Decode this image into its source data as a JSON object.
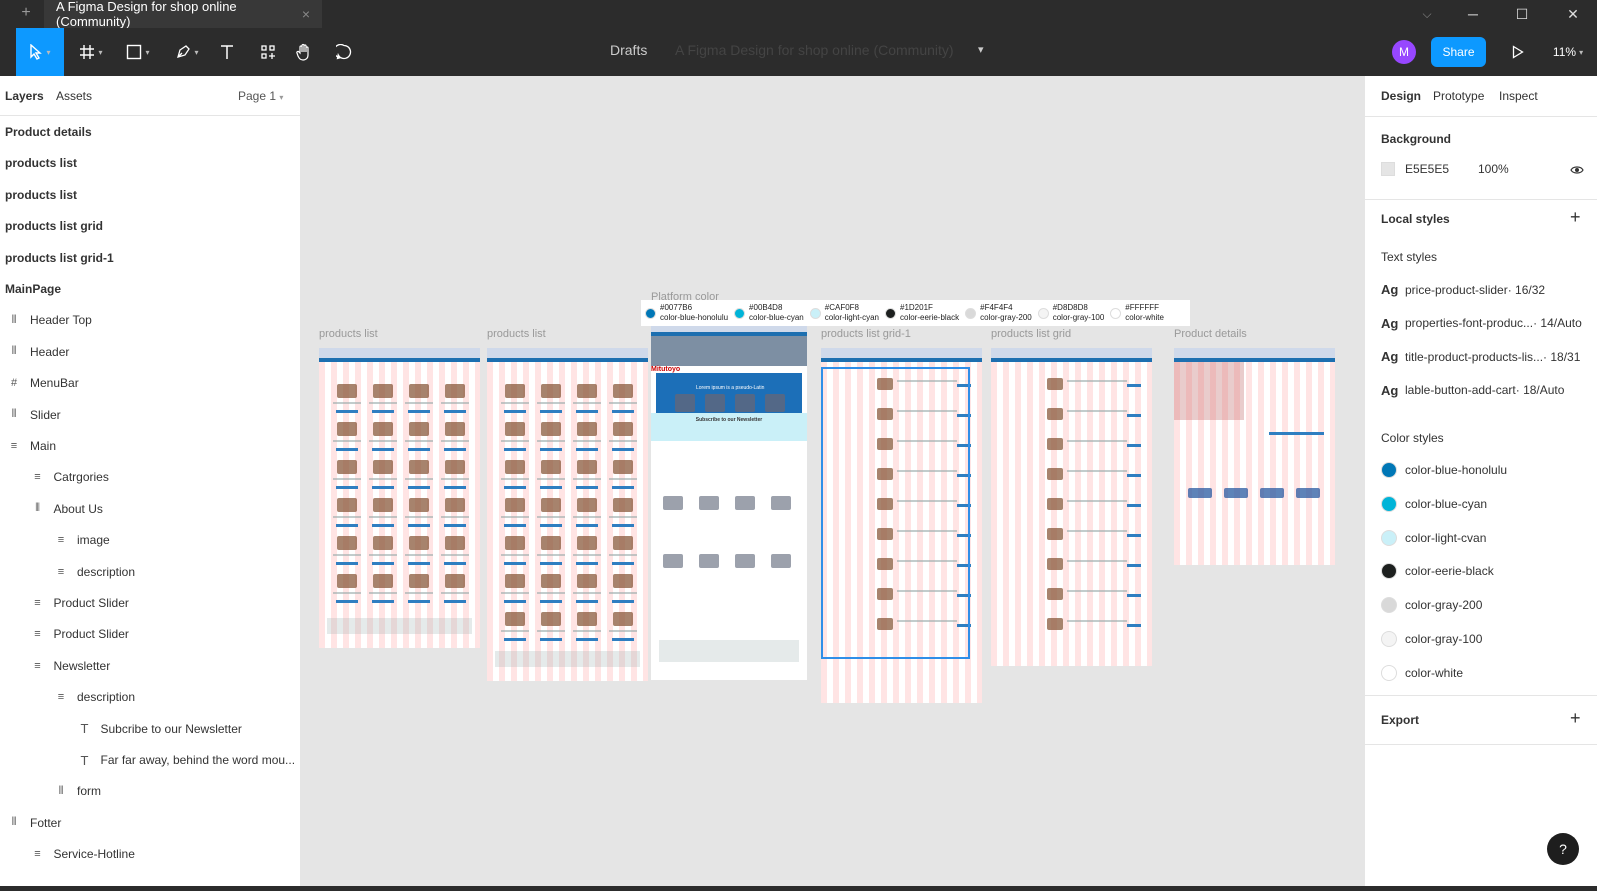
{
  "titlebar": {
    "plus": "+",
    "tab_title": "A Figma Design for shop online (Community)",
    "tab_close": "×",
    "chevron": "⌵",
    "minimize": "─",
    "maximize": "☐",
    "close": "✕"
  },
  "toolbar": {
    "location": "Drafts",
    "file_name": "A Figma Design for shop online (Community)",
    "avatar_initial": "M",
    "share_label": "Share",
    "zoom": "11%"
  },
  "left_panel": {
    "tabs": [
      "Layers",
      "Assets"
    ],
    "page_selector": "Page 1",
    "pages": [
      "Product details",
      "products list",
      "products list",
      "products list grid",
      "products list grid-1",
      "MainPage"
    ],
    "layers": [
      {
        "name": "Header Top",
        "icon": "auto-layout-icon",
        "glyph": "⫴",
        "indent": 0
      },
      {
        "name": "Header",
        "icon": "auto-layout-icon",
        "glyph": "⫴",
        "indent": 0
      },
      {
        "name": "MenuBar",
        "icon": "frame-icon",
        "glyph": "#",
        "indent": 0
      },
      {
        "name": "Slider",
        "icon": "auto-layout-icon",
        "glyph": "⫴",
        "indent": 0
      },
      {
        "name": "Main",
        "icon": "vertical-layout-icon",
        "glyph": "≡",
        "indent": 0
      },
      {
        "name": "Catrgories",
        "icon": "vertical-layout-icon",
        "glyph": "≡",
        "indent": 1
      },
      {
        "name": "About Us",
        "icon": "auto-layout-icon",
        "glyph": "⫴",
        "indent": 1
      },
      {
        "name": "image",
        "icon": "vertical-layout-icon",
        "glyph": "≡",
        "indent": 2
      },
      {
        "name": "description",
        "icon": "vertical-layout-icon",
        "glyph": "≡",
        "indent": 2
      },
      {
        "name": "Product Slider",
        "icon": "vertical-layout-icon",
        "glyph": "≡",
        "indent": 1
      },
      {
        "name": "Product Slider",
        "icon": "vertical-layout-icon",
        "glyph": "≡",
        "indent": 1
      },
      {
        "name": "Newsletter",
        "icon": "vertical-layout-icon",
        "glyph": "≡",
        "indent": 1
      },
      {
        "name": "description",
        "icon": "vertical-layout-icon",
        "glyph": "≡",
        "indent": 2
      },
      {
        "name": "Subcribe to our Newsletter",
        "icon": "text-icon",
        "glyph": "T",
        "indent": 3
      },
      {
        "name": "Far far away, behind the word mou...",
        "icon": "text-icon",
        "glyph": "T",
        "indent": 3
      },
      {
        "name": "form",
        "icon": "auto-layout-icon",
        "glyph": "⫴",
        "indent": 2
      },
      {
        "name": "Fotter",
        "icon": "auto-layout-icon",
        "glyph": "⫴",
        "indent": 0
      },
      {
        "name": "Service-Hotline",
        "icon": "vertical-layout-icon",
        "glyph": "≡",
        "indent": 1
      }
    ]
  },
  "canvas": {
    "frames": [
      {
        "label": "products  list"
      },
      {
        "label": "products  list"
      },
      {
        "label": "Platform color"
      },
      {
        "label": "products  list grid-1"
      },
      {
        "label": "products  list grid"
      },
      {
        "label": "Product details"
      }
    ],
    "palette": [
      {
        "hex": "#0077B6",
        "name": "color-blue-honolulu",
        "color": "#0077b6"
      },
      {
        "hex": "#00B4D8",
        "name": "color-blue-cyan",
        "color": "#00b4d8"
      },
      {
        "hex": "#CAF0F8",
        "name": "color-light-cyan",
        "color": "#caf0f8"
      },
      {
        "hex": "#1D201F",
        "name": "color-eerie-black",
        "color": "#1d201f"
      },
      {
        "hex": "#F4F4F4",
        "name": "color-gray-200",
        "color": "#d9d9d9"
      },
      {
        "hex": "#D8D8D8",
        "name": "color-gray-100",
        "color": "#f4f4f4"
      },
      {
        "hex": "#FFFFFF",
        "name": "color-white",
        "color": "#ffffff"
      }
    ],
    "mainpage_promo": "Lorem ipsum is a pseudo-Latin",
    "mainpage_brand": "Mitutoyo",
    "mainpage_newsletter": "Subscribe to our Newsletter"
  },
  "right_panel": {
    "tabs": [
      "Design",
      "Prototype",
      "Inspect"
    ],
    "background_title": "Background",
    "background_hex": "E5E5E5",
    "background_opacity": "100%",
    "local_styles": "Local styles",
    "text_styles_title": "Text styles",
    "text_styles": [
      {
        "name": "price-product-slider",
        "meta": " · 16/32"
      },
      {
        "name": "properties-font-produc...",
        "meta": " · 14/Auto"
      },
      {
        "name": "title-product-products-lis...",
        "meta": " · 18/31"
      },
      {
        "name": "lable-button-add-cart",
        "meta": " · 18/Auto"
      }
    ],
    "color_styles_title": "Color styles",
    "color_styles": [
      {
        "name": "color-blue-honolulu",
        "color": "#0077b6"
      },
      {
        "name": "color-blue-cyan",
        "color": "#00b4d8"
      },
      {
        "name": "color-light-cvan",
        "color": "#caf0f8"
      },
      {
        "name": "color-eerie-black",
        "color": "#1d201f"
      },
      {
        "name": "color-gray-200",
        "color": "#d9d9d9"
      },
      {
        "name": "color-gray-100",
        "color": "#f4f4f4"
      },
      {
        "name": "color-white",
        "color": "#ffffff"
      }
    ],
    "export_title": "Export",
    "plus": "+",
    "help": "?"
  }
}
